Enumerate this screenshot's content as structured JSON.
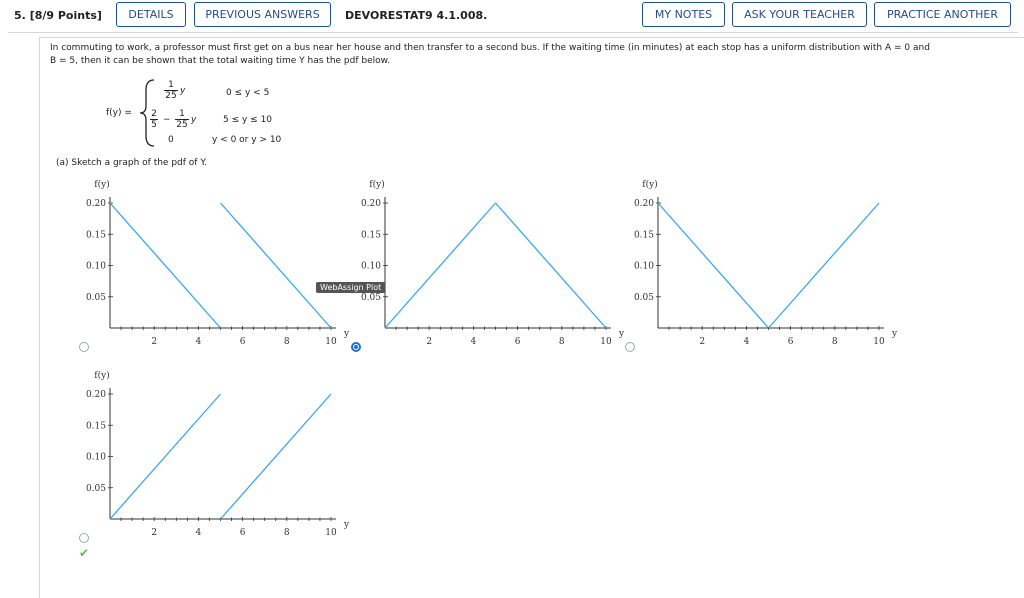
{
  "header": {
    "question_number": "5.",
    "points": "[8/9 Points]",
    "details": "DETAILS",
    "previous_answers": "PREVIOUS ANSWERS",
    "question_id": "DEVORESTAT9 4.1.008.",
    "my_notes": "MY NOTES",
    "ask_teacher": "ASK YOUR TEACHER",
    "practice_another": "PRACTICE ANOTHER"
  },
  "question": {
    "line1": "In commuting to work, a professor must first get on a bus near her house and then transfer to a second bus. If the waiting time (in minutes) at each stop has a uniform distribution with A = 0 and",
    "line2": "B = 5, then it can be shown that the total waiting time Y has the pdf below.",
    "fy": "f(y) =",
    "case1_num": "1",
    "case1_den": "25",
    "case1_y": "y",
    "case1_cond": "0 ≤ y < 5",
    "case2_a_num": "2",
    "case2_a_den": "5",
    "case2_minus": "−",
    "case2_b_num": "1",
    "case2_b_den": "25",
    "case2_y": "y",
    "case2_cond": "5 ≤ y ≤ 10",
    "case3": "0",
    "case3_cond": "y < 0 or y > 10"
  },
  "part_a": "(a)   Sketch a graph of the pdf of Y.",
  "plot": {
    "ylabel": "f(y)",
    "xlabel": "y",
    "yticks": [
      "0.20",
      "0.15",
      "0.10",
      "0.05"
    ],
    "xticks": [
      "2",
      "4",
      "6",
      "8",
      "10"
    ],
    "tooltip": "WebAssign Plot"
  },
  "options": [
    {
      "id": "A",
      "selected": false,
      "shape": "two decreasing lines"
    },
    {
      "id": "B",
      "selected": true,
      "shape": "triangle peak"
    },
    {
      "id": "C",
      "selected": false,
      "shape": "V shape"
    },
    {
      "id": "D",
      "selected": false,
      "shape": "two increasing lines"
    }
  ],
  "colors": {
    "accent": "#1f4e89",
    "line": "#3aa9e4",
    "correct": "#5cb85c"
  }
}
